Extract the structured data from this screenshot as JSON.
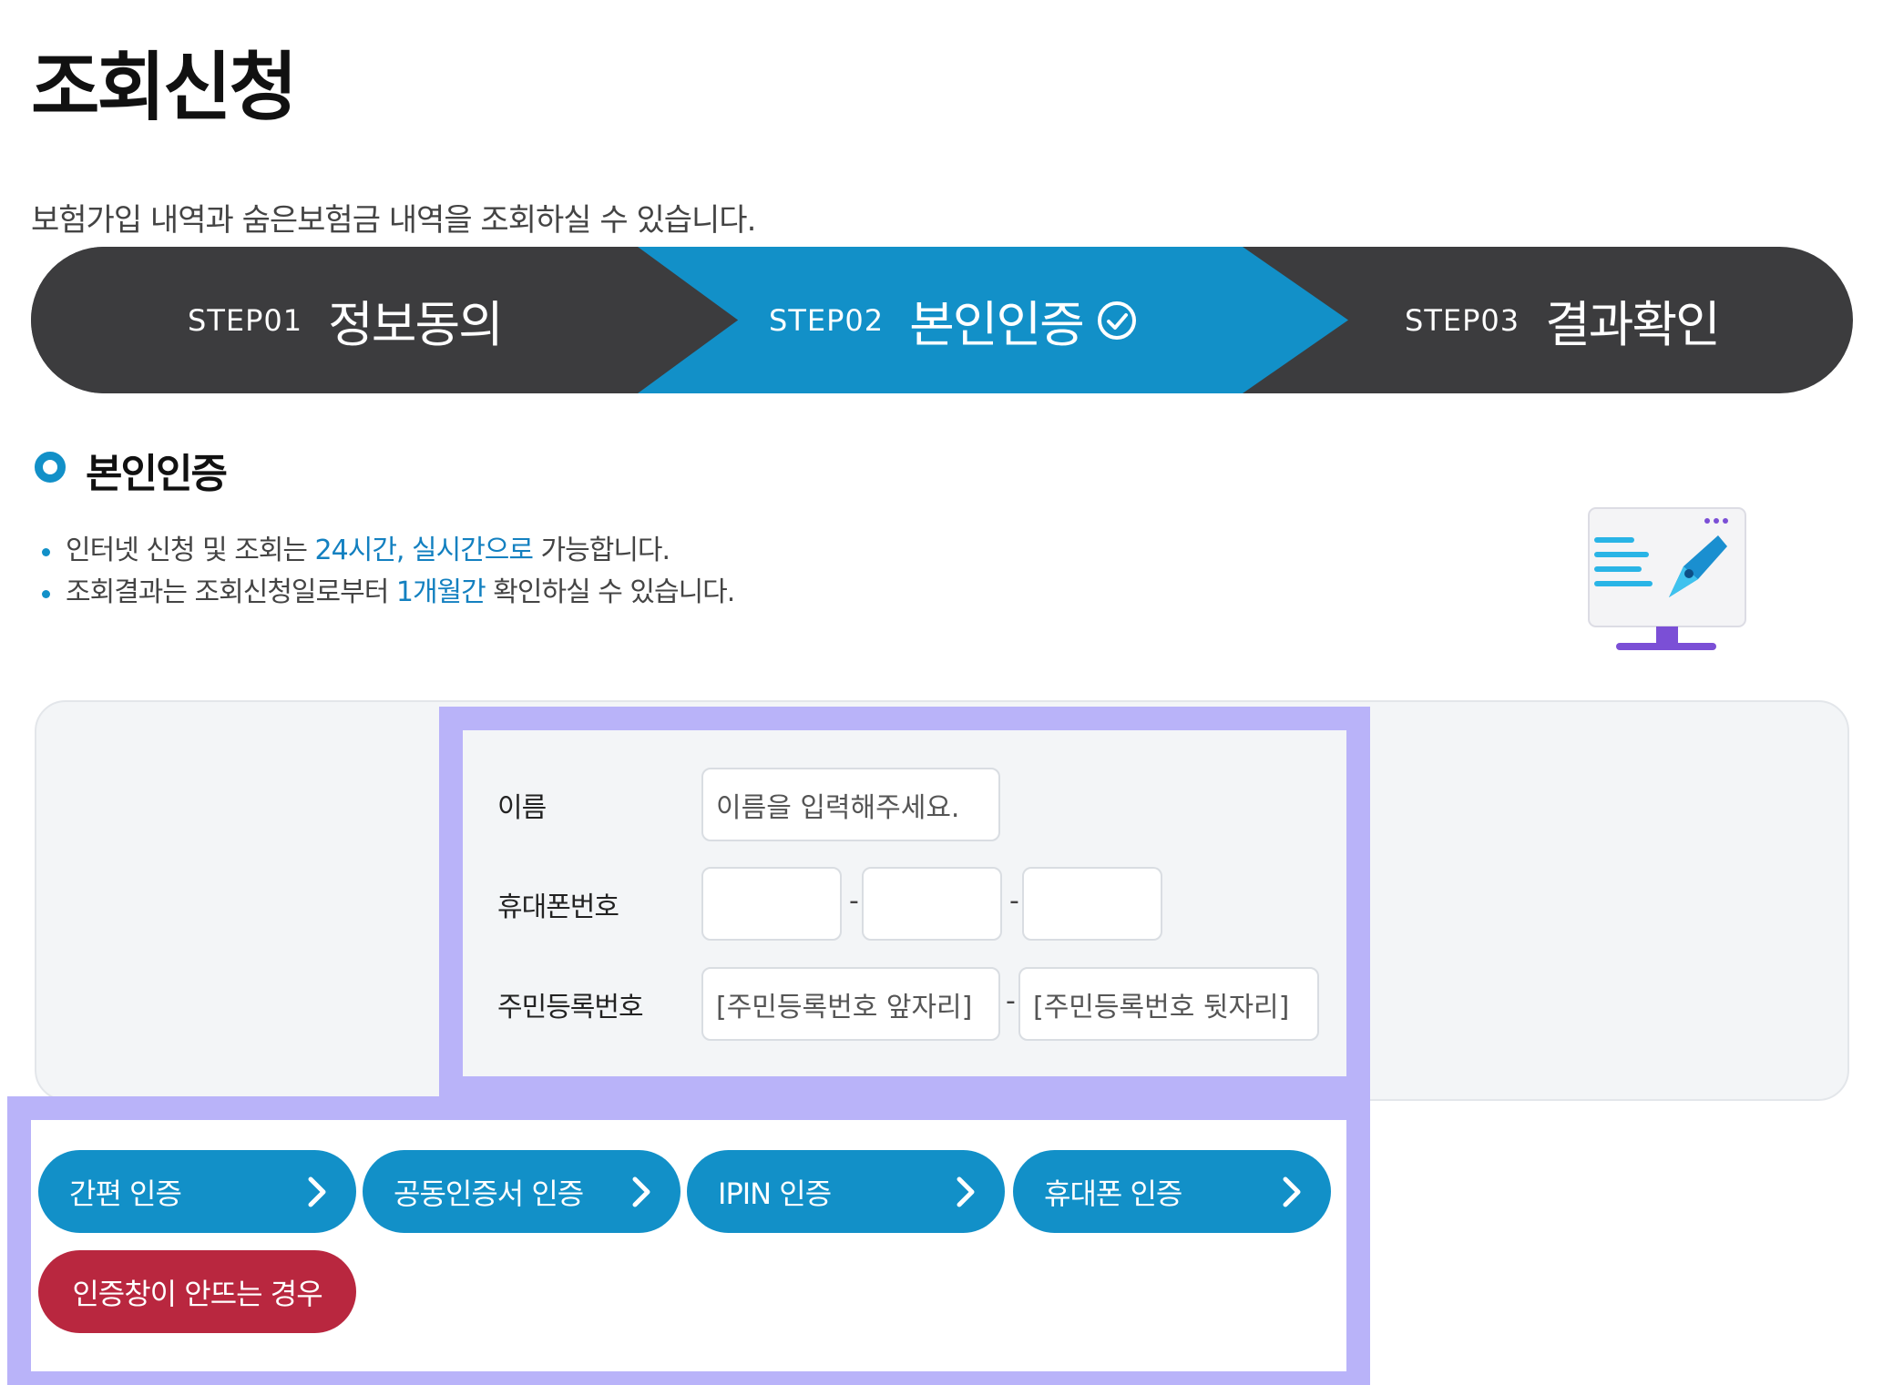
{
  "page": {
    "title": "조회신청",
    "subtitle": "보험가입 내역과 숨은보험금 내역을 조회하실 수 있습니다."
  },
  "steps": [
    {
      "num": "STEP01",
      "label": "정보동의"
    },
    {
      "num": "STEP02",
      "label": "본인인증",
      "active": true
    },
    {
      "num": "STEP03",
      "label": "결과확인"
    }
  ],
  "section": {
    "title": "본인인증",
    "info": [
      {
        "pre": "인터넷 신청 및 조회는 ",
        "highlight": "24시간, 실시간으로",
        "post": " 가능합니다."
      },
      {
        "pre": "조회결과는 조회신청일로부터 ",
        "highlight": "1개월간",
        "post": " 확인하실 수 있습니다."
      }
    ]
  },
  "form": {
    "name_label": "이름",
    "name_placeholder": "이름을 입력해주세요.",
    "phone_label": "휴대폰번호",
    "phone_sep": "-",
    "rrn_label": "주민등록번호",
    "rrn_front_placeholder": "[주민등록번호 앞자리]",
    "rrn_back_placeholder": "[주민등록번호 뒷자리]",
    "rrn_sep": "-"
  },
  "buttons": {
    "simple_auth": "간편 인증",
    "cert_auth": "공동인증서 인증",
    "ipin_auth": "IPIN 인증",
    "phone_auth": "휴대폰 인증",
    "help": "인증창이 안뜨는 경우"
  },
  "colors": {
    "primary": "#1290c8",
    "dark": "#3c3c3e",
    "danger": "#b9273f",
    "highlight_frame": "#b9b3f9"
  }
}
